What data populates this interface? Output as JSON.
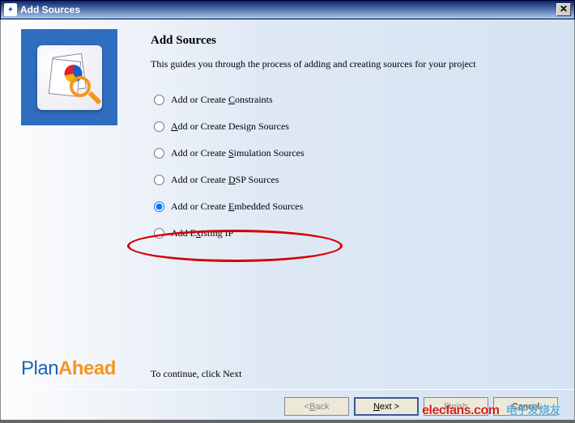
{
  "window": {
    "title": "Add Sources"
  },
  "header": {
    "title": "Add Sources",
    "subtitle": "This guides you through the process of adding and creating sources for your project"
  },
  "options": {
    "constraints": {
      "pre": "Add or Create ",
      "mn": "C",
      "post": "onstraints"
    },
    "design_sources": {
      "pre": "",
      "mn": "A",
      "post": "dd or Create Design Sources"
    },
    "simulation": {
      "pre": "Add or Create ",
      "mn": "S",
      "post": "imulation Sources"
    },
    "dsp": {
      "pre": "Add or Create ",
      "mn": "D",
      "post": "SP Sources"
    },
    "embedded": {
      "pre": "Add or Create ",
      "mn": "E",
      "post": "mbedded Sources"
    },
    "existing_ip": {
      "pre": "Add E",
      "mn": "x",
      "post": "isting IP"
    }
  },
  "selected_option": "embedded",
  "continue_text": "To continue, click Next",
  "buttons": {
    "back": {
      "pre": "< ",
      "mn": "B",
      "post": "ack"
    },
    "next": {
      "pre": "",
      "mn": "N",
      "post": "ext >"
    },
    "finish": {
      "pre": "",
      "mn": "F",
      "post": "inish"
    },
    "cancel": {
      "label": "Cancel"
    }
  },
  "brand": {
    "plan": "Plan",
    "ahead": "Ahead"
  },
  "watermark": {
    "site": "elecfans.com",
    "cn": "电子发烧友"
  }
}
